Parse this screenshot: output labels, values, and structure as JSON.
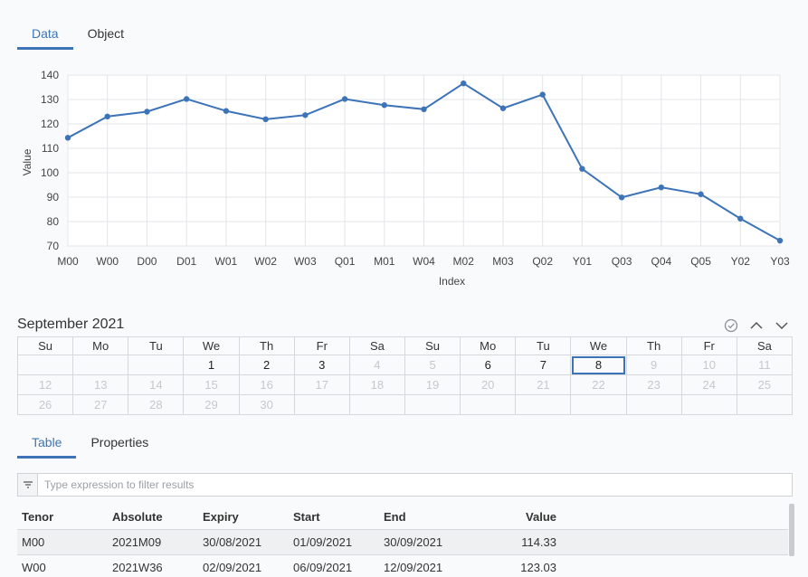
{
  "top_tabs": [
    {
      "label": "Data",
      "active": true
    },
    {
      "label": "Object",
      "active": false
    }
  ],
  "chart_data": {
    "type": "line",
    "categories": [
      "M00",
      "W00",
      "D00",
      "D01",
      "W01",
      "W02",
      "W03",
      "Q01",
      "M01",
      "W04",
      "M02",
      "M03",
      "Q02",
      "Y01",
      "Q03",
      "Q04",
      "Q05",
      "Y02",
      "Y03"
    ],
    "values": [
      114.33,
      123.03,
      125,
      130.2,
      125.3,
      121.9,
      123.6,
      130.2,
      127.7,
      126,
      136.6,
      126.4,
      132,
      101.6,
      89.9,
      94,
      91.2,
      81.2,
      72.2
    ],
    "title": "",
    "xlabel": "Index",
    "ylabel": "Value",
    "ylim": [
      70,
      140
    ],
    "yticks": [
      "70",
      "80",
      "90",
      "100",
      "110",
      "120",
      "130",
      "140"
    ],
    "grid": true,
    "line_color": "#3d74b8"
  },
  "calendar": {
    "title": "September 2021",
    "weekdays": [
      "Su",
      "Mo",
      "Tu",
      "We",
      "Th",
      "Fr",
      "Sa",
      "Su",
      "Mo",
      "Tu",
      "We",
      "Th",
      "Fr",
      "Sa"
    ],
    "rows": [
      [
        "",
        "",
        "",
        "1",
        "2",
        "3",
        "4",
        "5",
        "6",
        "7",
        "8",
        "9",
        "10",
        "11"
      ],
      [
        "12",
        "13",
        "14",
        "15",
        "16",
        "17",
        "18",
        "19",
        "20",
        "21",
        "22",
        "23",
        "24",
        "25"
      ],
      [
        "26",
        "27",
        "28",
        "29",
        "30",
        "",
        "",
        "",
        "",
        "",
        "",
        "",
        "",
        ""
      ]
    ],
    "enabled_days": [
      "1",
      "2",
      "3",
      "6",
      "7",
      "8"
    ],
    "selected_day": "8"
  },
  "bottom_tabs": [
    {
      "label": "Table",
      "active": true
    },
    {
      "label": "Properties",
      "active": false
    }
  ],
  "filter": {
    "placeholder": "Type expression to filter results"
  },
  "results": {
    "headers": [
      "Tenor",
      "Absolute",
      "Expiry",
      "Start",
      "End",
      "Value"
    ],
    "rows": [
      [
        "M00",
        "2021M09",
        "30/08/2021",
        "01/09/2021",
        "30/09/2021",
        "114.33"
      ],
      [
        "W00",
        "2021W36",
        "02/09/2021",
        "06/09/2021",
        "12/09/2021",
        "123.03"
      ]
    ]
  }
}
